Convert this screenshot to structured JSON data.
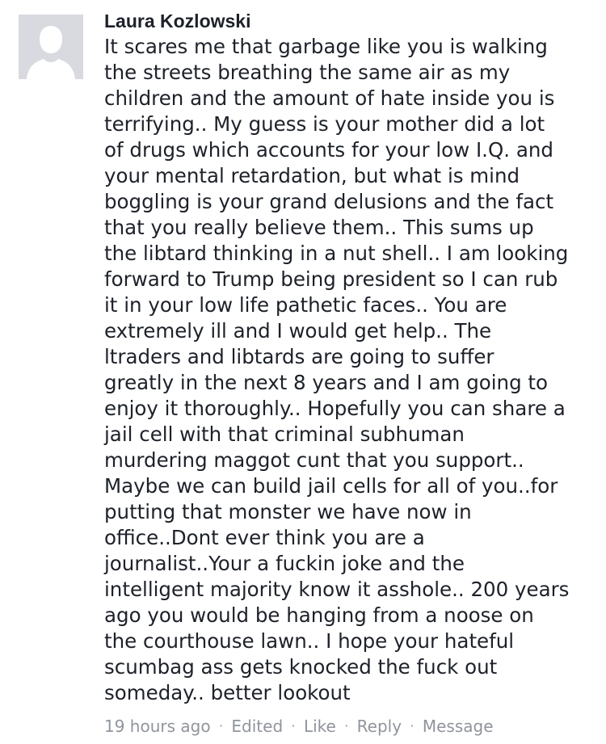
{
  "comment": {
    "author": "Laura Kozlowski",
    "avatar_icon": "default-silhouette-icon",
    "text_lines": [
      "It scares me that garbage like you is walking",
      "the streets breathing the same air as my",
      "children and the amount of hate inside you is",
      "terrifying.. My guess is your mother did a lot",
      "of drugs which accounts for your low I.Q. and",
      "your mental retardation, but what is mind",
      "boggling is your grand delusions and the fact",
      "that you really believe them.. This sums up",
      "the libtard thinking in a nut shell.. I am looking",
      "forward to Trump being president so I can rub",
      "it in your low life pathetic faces.. You are",
      "extremely ill and I would get help.. The",
      "ltraders and libtards are going to suffer",
      "greatly in the next 8 years and I am going to",
      "enjoy it thoroughly.. Hopefully you can share a",
      "jail cell with that criminal subhuman",
      "murdering maggot cunt that you support..",
      "Maybe we can build jail cells for all of you..for",
      "putting that monster we have now in",
      "office..Dont ever think you are a",
      "journalist..Your a fuckin joke and the",
      "intelligent majority know it asshole.. 200 years",
      "ago you would be hanging from a noose on",
      "the courthouse lawn.. I hope your hateful",
      "scumbag ass gets knocked the fuck out",
      "someday.. better lookout"
    ],
    "meta": {
      "timestamp": "19 hours ago",
      "edited": "Edited",
      "like": "Like",
      "reply": "Reply",
      "message": "Message",
      "separator": "·"
    }
  },
  "colors": {
    "text": "#1d2129",
    "meta": "#90949c",
    "avatar_bg": "#d8dadf",
    "avatar_figure": "#ffffff"
  }
}
